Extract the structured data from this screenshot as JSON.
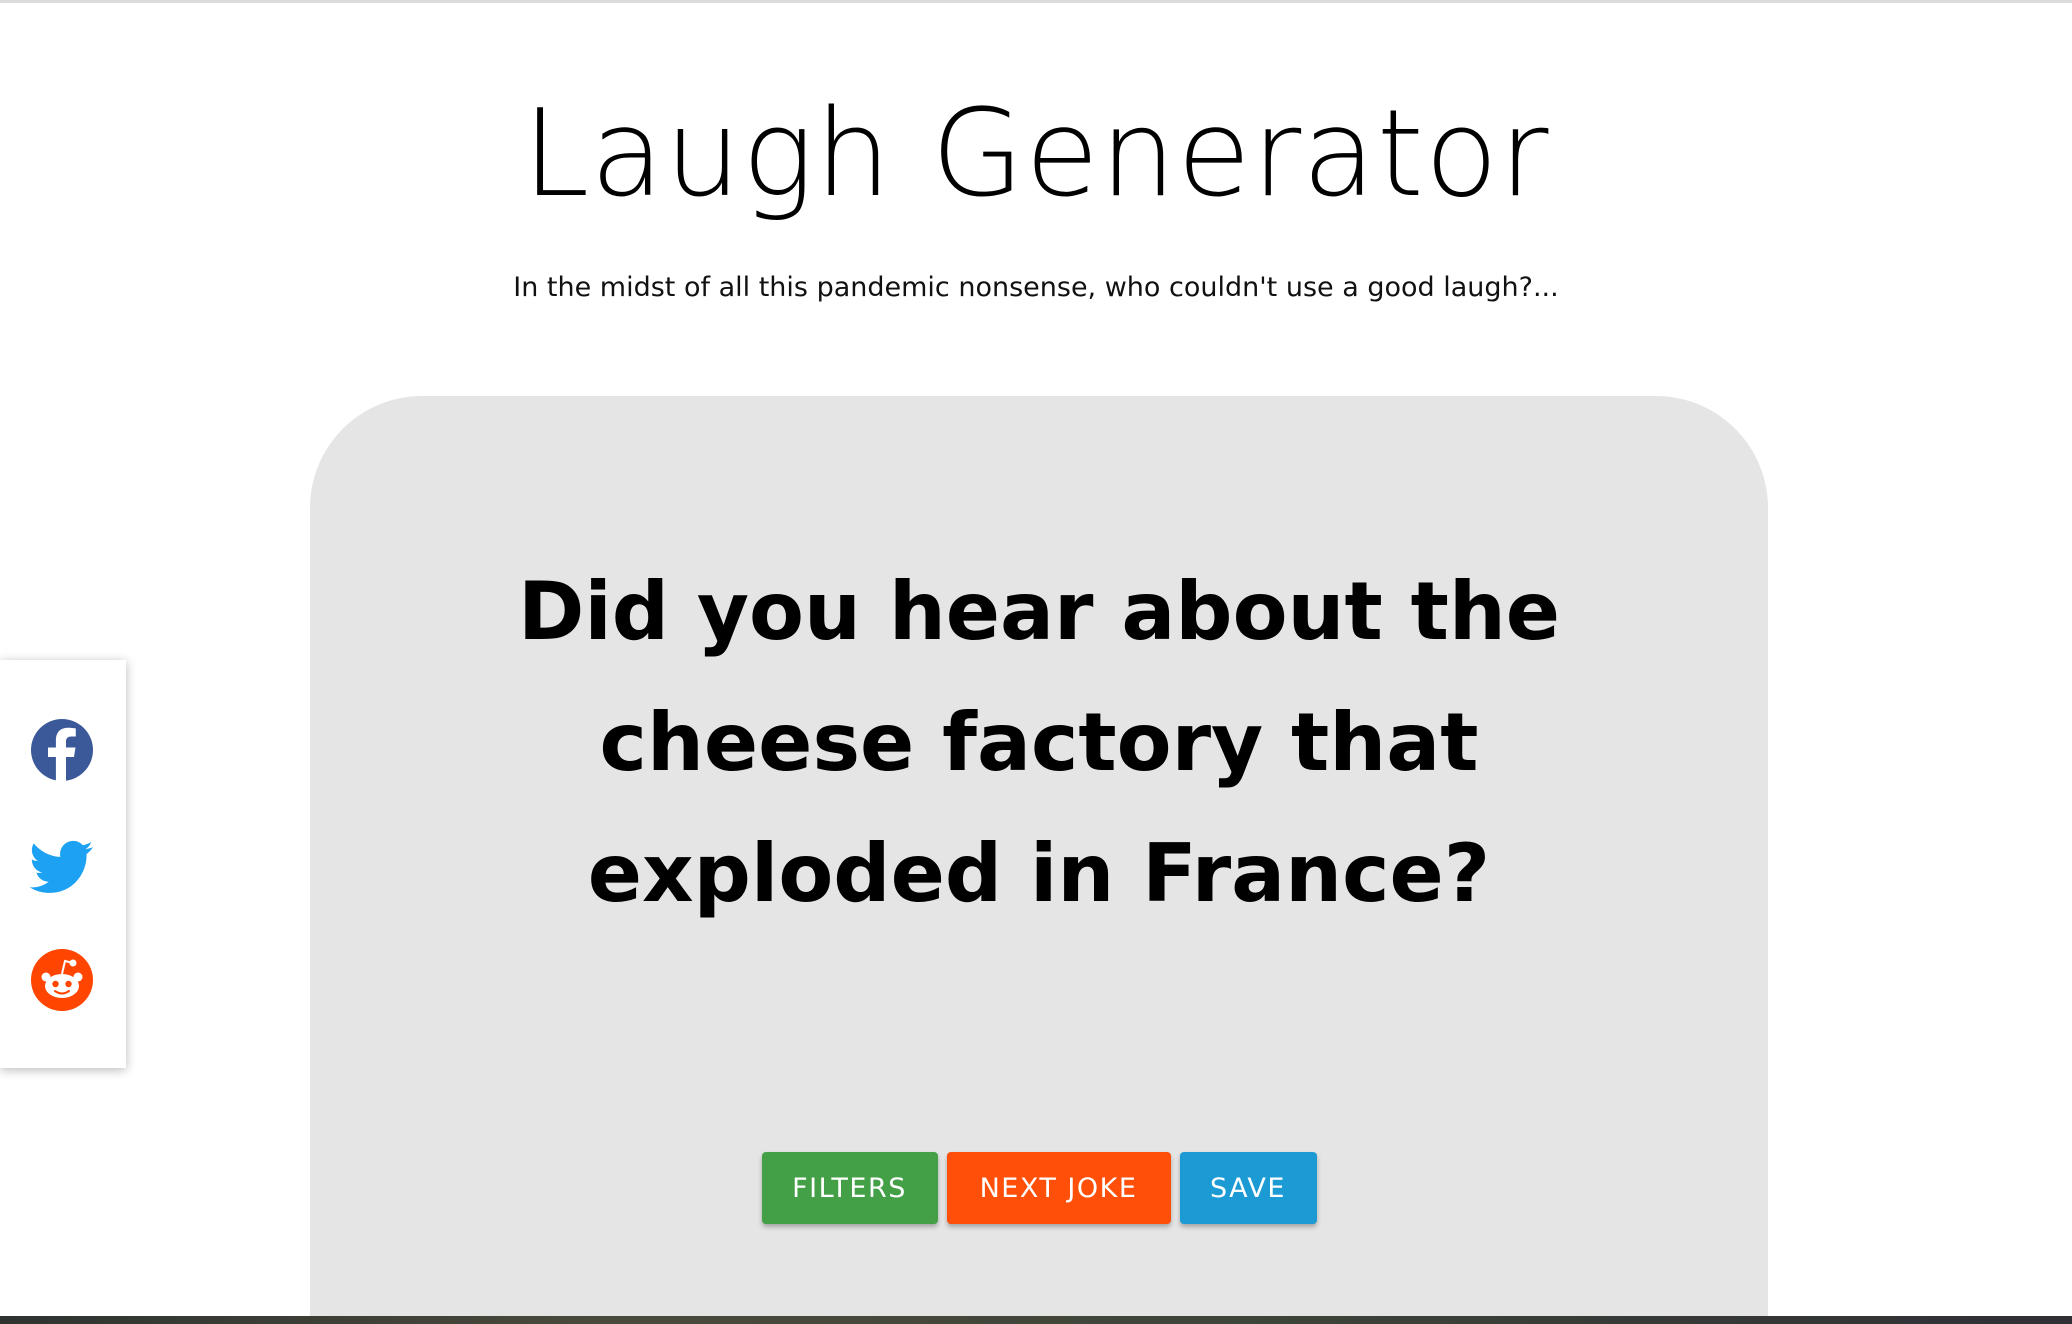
{
  "header": {
    "title": "Laugh Generator",
    "subtitle": "In the midst of all this pandemic nonsense, who couldn't use a good laugh?..."
  },
  "joke": {
    "text": "Did you hear about the cheese factory that exploded in France?"
  },
  "actions": {
    "filters_label": "FILTERS",
    "next_joke_label": "NEXT JOKE",
    "save_label": "SAVE"
  },
  "share": {
    "items": [
      {
        "icon": "facebook-icon",
        "color": "#3b5998"
      },
      {
        "icon": "twitter-icon",
        "color": "#1da1f2"
      },
      {
        "icon": "reddit-icon",
        "color": "#ff4500"
      }
    ]
  },
  "colors": {
    "card_background": "#e5e5e5",
    "filters_button": "#43a047",
    "next_joke_button": "#ff4f08",
    "save_button": "#1b9ad4"
  }
}
